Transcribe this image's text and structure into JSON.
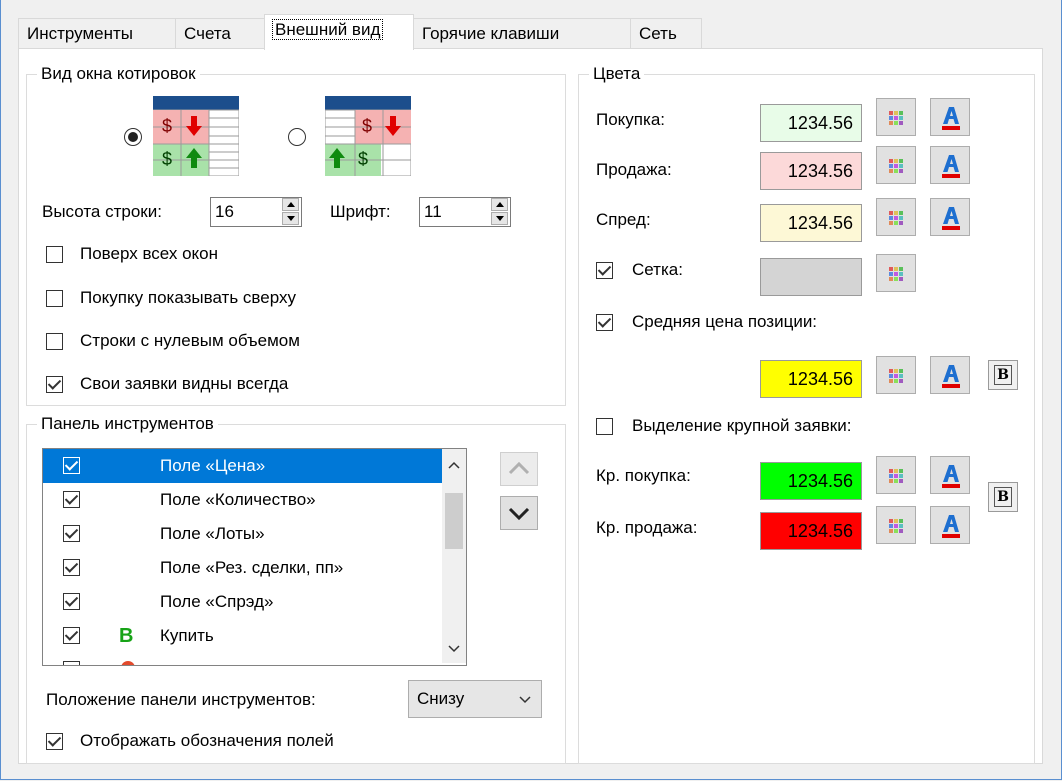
{
  "tabs": [
    "Инструменты",
    "Счета",
    "Внешний вид",
    "Горячие клавиши",
    "Сеть"
  ],
  "active_tab": "Внешний вид",
  "quote_window": {
    "title": "Вид окна котировок",
    "icon_glyph": "$",
    "row_height_label": "Высота строки:",
    "row_height_value": "16",
    "font_label": "Шрифт:",
    "font_value": "11",
    "options": [
      {
        "label": "Поверх всех окон",
        "checked": false
      },
      {
        "label": "Покупку показывать сверху",
        "checked": false
      },
      {
        "label": "Строки с нулевым объемом",
        "checked": false
      },
      {
        "label": "Свои заявки видны всегда",
        "checked": true
      }
    ]
  },
  "toolbar_panel": {
    "title": "Панель инструментов",
    "items": [
      {
        "label": "Поле «Цена»",
        "checked": true,
        "icon": ""
      },
      {
        "label": "Поле «Количество»",
        "checked": true,
        "icon": ""
      },
      {
        "label": "Поле «Лоты»",
        "checked": true,
        "icon": ""
      },
      {
        "label": "Поле «Рез. сделки, пп»",
        "checked": true,
        "icon": ""
      },
      {
        "label": "Поле «Спрэд»",
        "checked": true,
        "icon": ""
      },
      {
        "label": "Купить",
        "checked": true,
        "icon": "B"
      }
    ],
    "position_label": "Положение панели инструментов:",
    "position_value": "Снизу",
    "show_field_labels": "Отображать обозначения полей"
  },
  "colors": {
    "title": "Цвета",
    "sample": "1234.56",
    "buy_label": "Покупка:",
    "sell_label": "Продажа:",
    "spread_label": "Спред:",
    "grid_label": "Сетка:",
    "avg_price_label": "Средняя цена позиции:",
    "large_order_label": "Выделение крупной заявки:",
    "large_buy_label": "Кр. покупка:",
    "large_sell_label": "Кр. продажа:",
    "bold_glyph": "B",
    "buy_color": "#e8fce8",
    "sell_color": "#fcd9d9",
    "spread_color": "#fdf8d6",
    "grid_color": "#d4d4d4",
    "avg_color": "#ffff00",
    "large_buy_color": "#00ff00",
    "large_sell_color": "#ff0000"
  }
}
